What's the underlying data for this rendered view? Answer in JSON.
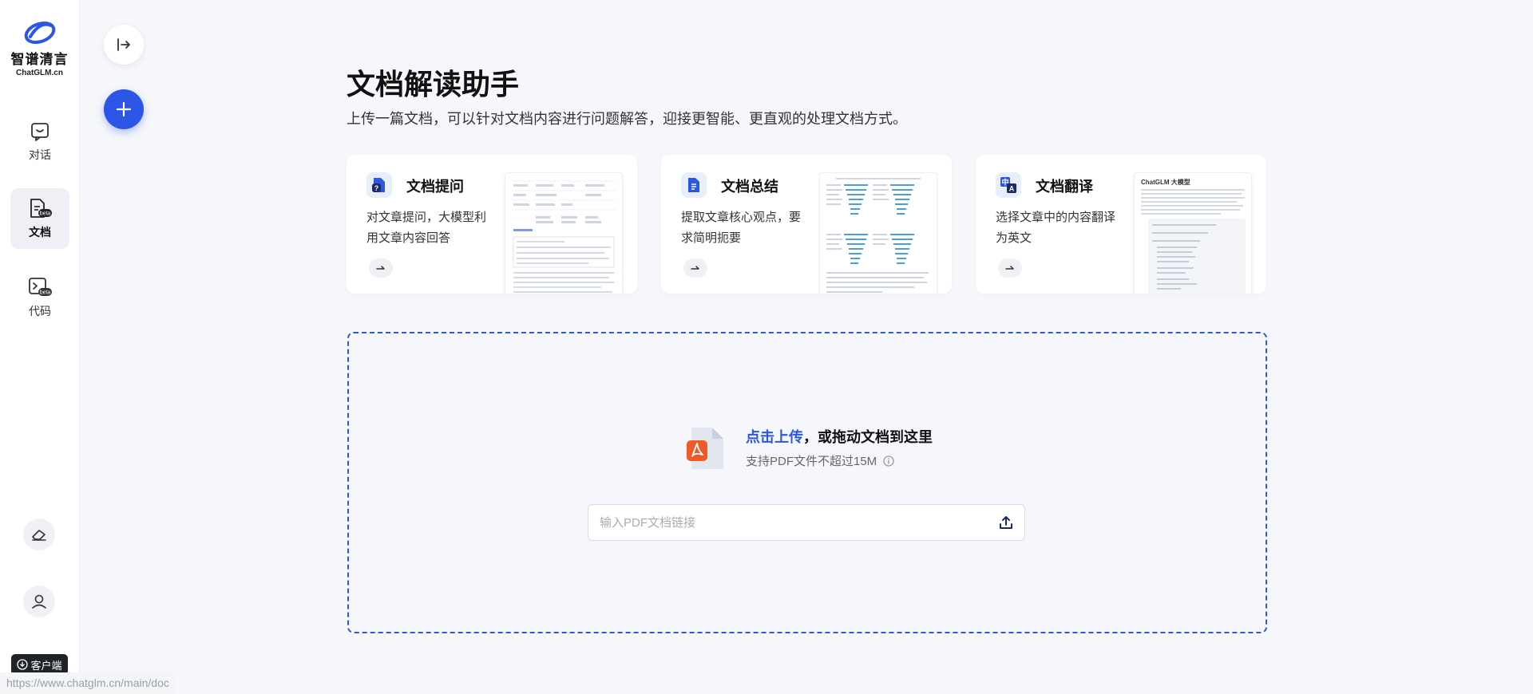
{
  "brand": {
    "name_cn": "智谱清言",
    "domain": "ChatGLM.cn",
    "accent": "#2c56e6"
  },
  "nav": [
    {
      "label": "对话",
      "icon": "chat-icon",
      "badge": ""
    },
    {
      "label": "文档",
      "icon": "document-icon",
      "badge": "beta",
      "active": true
    },
    {
      "label": "代码",
      "icon": "code-icon",
      "badge": "beta"
    }
  ],
  "sidebar_bottom": {
    "client_label": "客户端"
  },
  "status_url": "https://www.chatglm.cn/main/doc",
  "page": {
    "title": "文档解读助手",
    "subtitle": "上传一篇文档，可以针对文档内容进行问题解答，迎接更智能、更直观的处理文档方式。"
  },
  "cards": [
    {
      "title": "文档提问",
      "desc": "对文章提问，大模型利用文章内容回答",
      "icon": "doc-question-icon"
    },
    {
      "title": "文档总结",
      "desc": "提取文章核心观点，要求简明扼要",
      "icon": "doc-summary-icon"
    },
    {
      "title": "文档翻译",
      "desc": "选择文章中的内容翻译为英文",
      "icon": "doc-translate-icon",
      "thumb_title": "ChatGLM 大模型"
    }
  ],
  "upload": {
    "link_text": "点击上传",
    "rest_text": "，或拖动文档到这里",
    "hint": "支持PDF文件不超过15M",
    "url_placeholder": "输入PDF文档链接"
  }
}
